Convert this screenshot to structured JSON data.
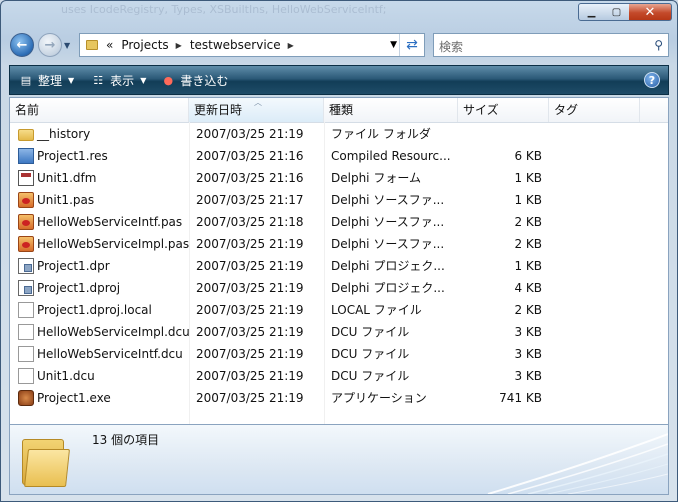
{
  "window": {
    "ghost_title": "uses IcodeRegistry, Types, XSBuiltIns, HelloWebServiceIntf;"
  },
  "nav": {
    "address_overflow": "«",
    "address_segments": [
      "Projects",
      "testwebservice"
    ],
    "search_placeholder": "検索"
  },
  "toolbar": {
    "organize": "整理",
    "views": "表示",
    "burn": "書き込む"
  },
  "columns": {
    "name": "名前",
    "modified": "更新日時",
    "type": "種類",
    "size": "サイズ",
    "tags": "タグ"
  },
  "files": [
    {
      "name": "__history",
      "date": "2007/03/25 21:19",
      "type": "ファイル フォルダ",
      "size": "",
      "icon": "folder-icon"
    },
    {
      "name": "Project1.res",
      "date": "2007/03/25 21:16",
      "type": "Compiled Resourc...",
      "size": "6 KB",
      "icon": "resource-file-icon"
    },
    {
      "name": "Unit1.dfm",
      "date": "2007/03/25 21:16",
      "type": "Delphi フォーム",
      "size": "1 KB",
      "icon": "delphi-form-icon"
    },
    {
      "name": "Unit1.pas",
      "date": "2007/03/25 21:17",
      "type": "Delphi ソースファ...",
      "size": "1 KB",
      "icon": "delphi-source-icon"
    },
    {
      "name": "HelloWebServiceIntf.pas",
      "date": "2007/03/25 21:18",
      "type": "Delphi ソースファ...",
      "size": "2 KB",
      "icon": "delphi-source-icon"
    },
    {
      "name": "HelloWebServiceImpl.pas",
      "date": "2007/03/25 21:19",
      "type": "Delphi ソースファ...",
      "size": "2 KB",
      "icon": "delphi-source-icon"
    },
    {
      "name": "Project1.dpr",
      "date": "2007/03/25 21:19",
      "type": "Delphi プロジェク...",
      "size": "1 KB",
      "icon": "delphi-project-icon"
    },
    {
      "name": "Project1.dproj",
      "date": "2007/03/25 21:19",
      "type": "Delphi プロジェク...",
      "size": "4 KB",
      "icon": "delphi-project-icon"
    },
    {
      "name": "Project1.dproj.local",
      "date": "2007/03/25 21:19",
      "type": "LOCAL ファイル",
      "size": "2 KB",
      "icon": "generic-file-icon"
    },
    {
      "name": "HelloWebServiceImpl.dcu",
      "date": "2007/03/25 21:19",
      "type": "DCU ファイル",
      "size": "3 KB",
      "icon": "generic-file-icon"
    },
    {
      "name": "HelloWebServiceIntf.dcu",
      "date": "2007/03/25 21:19",
      "type": "DCU ファイル",
      "size": "3 KB",
      "icon": "generic-file-icon"
    },
    {
      "name": "Unit1.dcu",
      "date": "2007/03/25 21:19",
      "type": "DCU ファイル",
      "size": "3 KB",
      "icon": "generic-file-icon"
    },
    {
      "name": "Project1.exe",
      "date": "2007/03/25 21:19",
      "type": "アプリケーション",
      "size": "741 KB",
      "icon": "application-exe-icon"
    }
  ],
  "details": {
    "item_count": "13 個の項目"
  }
}
